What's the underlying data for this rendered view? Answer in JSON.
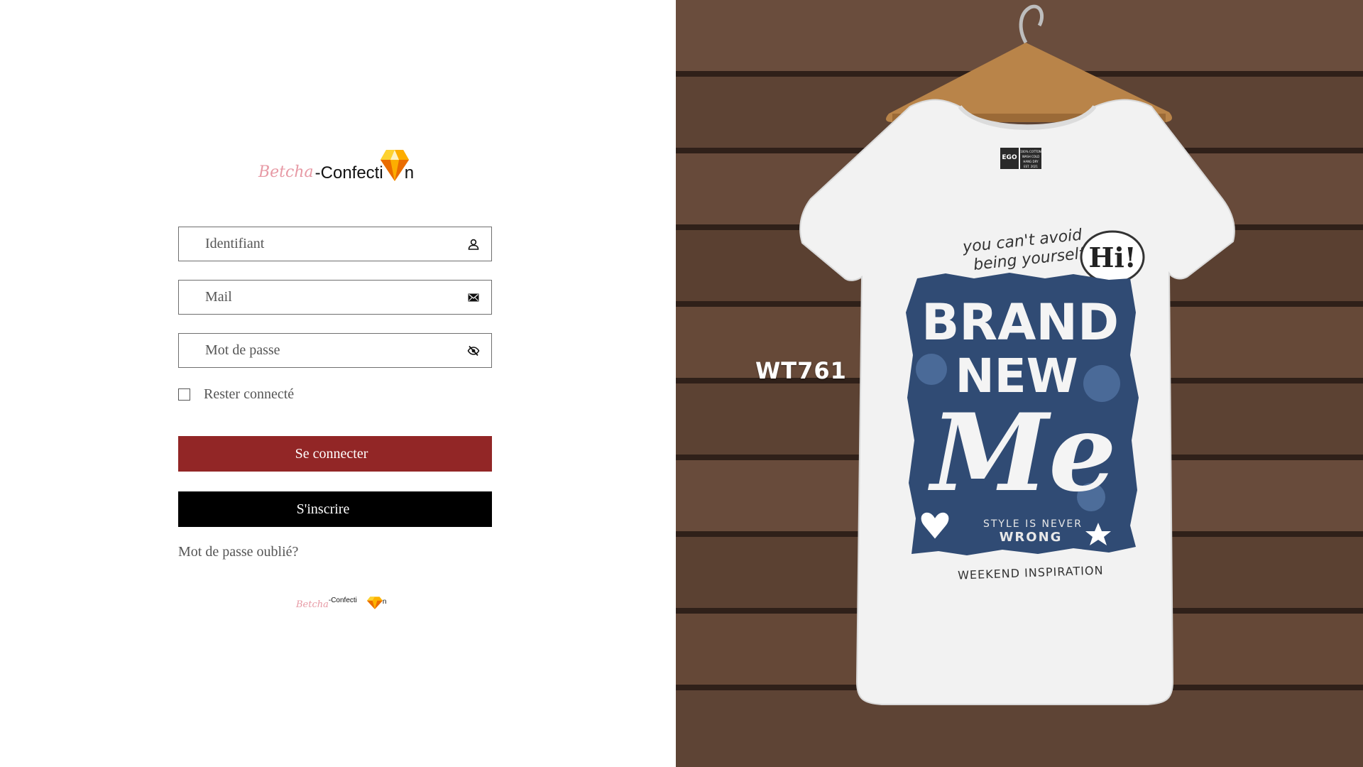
{
  "brand": {
    "script": "Betcha",
    "word": "-Confecti",
    "tail": "n"
  },
  "form": {
    "username_placeholder": "Identifiant",
    "email_placeholder": "Mail",
    "password_placeholder": "Mot de passe",
    "remember_label": "Rester connecté",
    "login_label": "Se connecter",
    "signup_label": "S'inscrire",
    "forgot_label": "Mot de passe oublié?"
  },
  "colors": {
    "login_button": "#922626",
    "signup_button": "#000000",
    "brand_script": "#e79aa5"
  },
  "icons": {
    "username": "user-icon",
    "email": "envelope-icon",
    "password": "eye-slash-icon",
    "logo_gem": "diamond-icon"
  },
  "photo": {
    "product_code": "WT761",
    "shirt_text": {
      "line1": "you can't avoid",
      "line2": "being yourself.",
      "bubble": "Hi!",
      "big1": "BRAND",
      "big2": "NEW",
      "script": "Me",
      "small1": "STYLE IS NEVER",
      "small2": "WRONG",
      "footer": "WEEKEND INSPIRATION",
      "tag_brand": "EGO",
      "tag_1": "100% COTTON",
      "tag_2": "WASH COLD",
      "tag_3": "HANG DRY",
      "tag_4": "EST. 2021"
    }
  }
}
